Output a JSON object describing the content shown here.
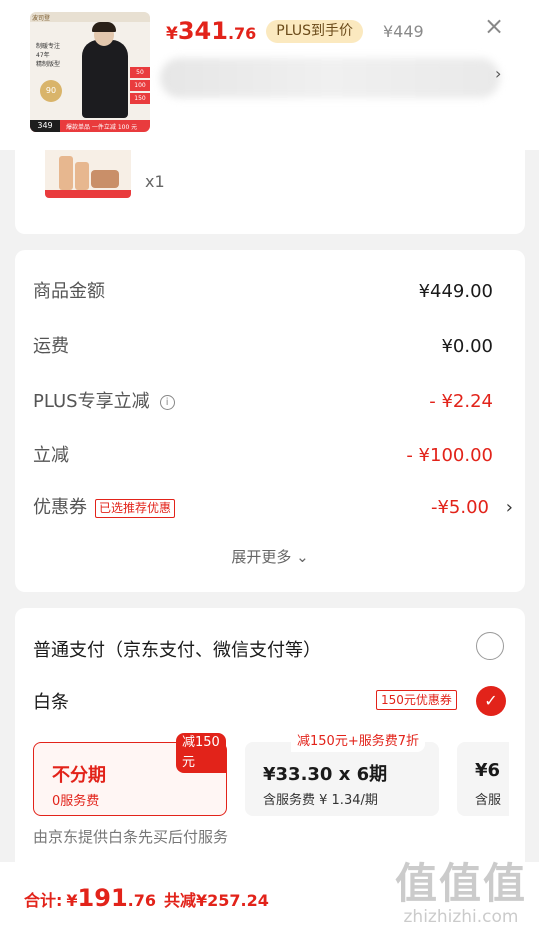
{
  "header": {
    "price": {
      "currency": "¥",
      "integer": "341",
      "decimal": ".76"
    },
    "plus_badge": "PLUS到手价",
    "original_price": "¥449",
    "close_icon": "close-icon",
    "chevron_icon": "chevron-right-icon",
    "thumb": {
      "brand_tag": "波司登",
      "left_text": [
        "制暖专注",
        "47年",
        "精制版型"
      ],
      "circle": "90",
      "side_badges": [
        "50",
        "100",
        "150"
      ],
      "price_tag": "349",
      "promo": "爆款单品 一件立减 100 元"
    }
  },
  "product": {
    "quantity": "x1"
  },
  "breakdown": {
    "rows": [
      {
        "label": "商品金额",
        "value": "¥449.00"
      },
      {
        "label": "运费",
        "value": "¥0.00"
      },
      {
        "label": "PLUS专享立减",
        "value": "- ¥2.24"
      },
      {
        "label": "立减",
        "value": "- ¥100.00"
      },
      {
        "label": "优惠券",
        "value": "-¥5.00",
        "tag": "已选推荐优惠"
      }
    ],
    "expand": "展开更多 ⌄"
  },
  "payment": {
    "option1": "普通支付（京东支付、微信支付等）",
    "option2": "白条",
    "coupon": "150元优惠券",
    "plans": [
      {
        "title": "不分期",
        "sub": "0服务费",
        "badge": "减150元"
      },
      {
        "title": "¥33.30 x 6期",
        "sub": "含服务费 ¥ 1.34/期",
        "badge": "减150元+服务费7折"
      },
      {
        "title": "¥6",
        "sub": "含服"
      }
    ],
    "provider": "由京东提供白条先买后付服务"
  },
  "total": {
    "label": "合计:",
    "currency": "¥",
    "integer": "191",
    "decimal": ".76",
    "saved": "共减¥257.24"
  },
  "watermark": {
    "big": "值值值",
    "small": "zhizhizhi.com"
  },
  "colors": {
    "accent": "#e2231a",
    "background": "#f2f2f2",
    "plus_gold": "#fbe9bf"
  }
}
